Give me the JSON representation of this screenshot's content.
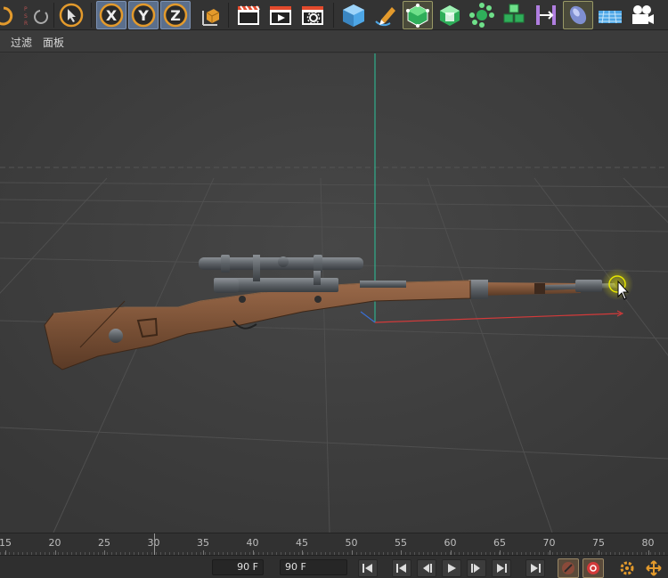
{
  "menu": {
    "filter": "过滤",
    "panel": "面板"
  },
  "axes": {
    "x": "X",
    "y": "Y",
    "z": "Z"
  },
  "timeline": {
    "ticks": [
      "15",
      "20",
      "25",
      "30",
      "35",
      "40",
      "45",
      "50",
      "55",
      "60",
      "65",
      "70",
      "75",
      "80"
    ],
    "current_frame": 30
  },
  "transport": {
    "end_frame": "90 F",
    "max_frame": "90 F"
  },
  "colors": {
    "y_axis": "#2fae8c",
    "x_axis": "#d33a3a",
    "selection_highlight": "#e6e600",
    "wood": "#7a5136"
  },
  "icons": {
    "undo": "undo-icon",
    "move_keys": "key-psr-icon",
    "live_select": "cursor-arrow-icon",
    "render_view": "clapper-icon",
    "render_picture": "render-play-icon",
    "render_settings": "render-settings-icon",
    "cube": "cube-icon",
    "pen": "pen-icon",
    "subdivision": "subdivision-cube-icon",
    "extrude": "extrude-cube-icon",
    "mograph": "mograph-cloner-icon",
    "generator": "stacked-cubes-icon",
    "deformer": "deformer-bend-icon",
    "field": "field-capsule-icon",
    "floor": "floor-grid-icon",
    "camera": "camera-icon"
  }
}
